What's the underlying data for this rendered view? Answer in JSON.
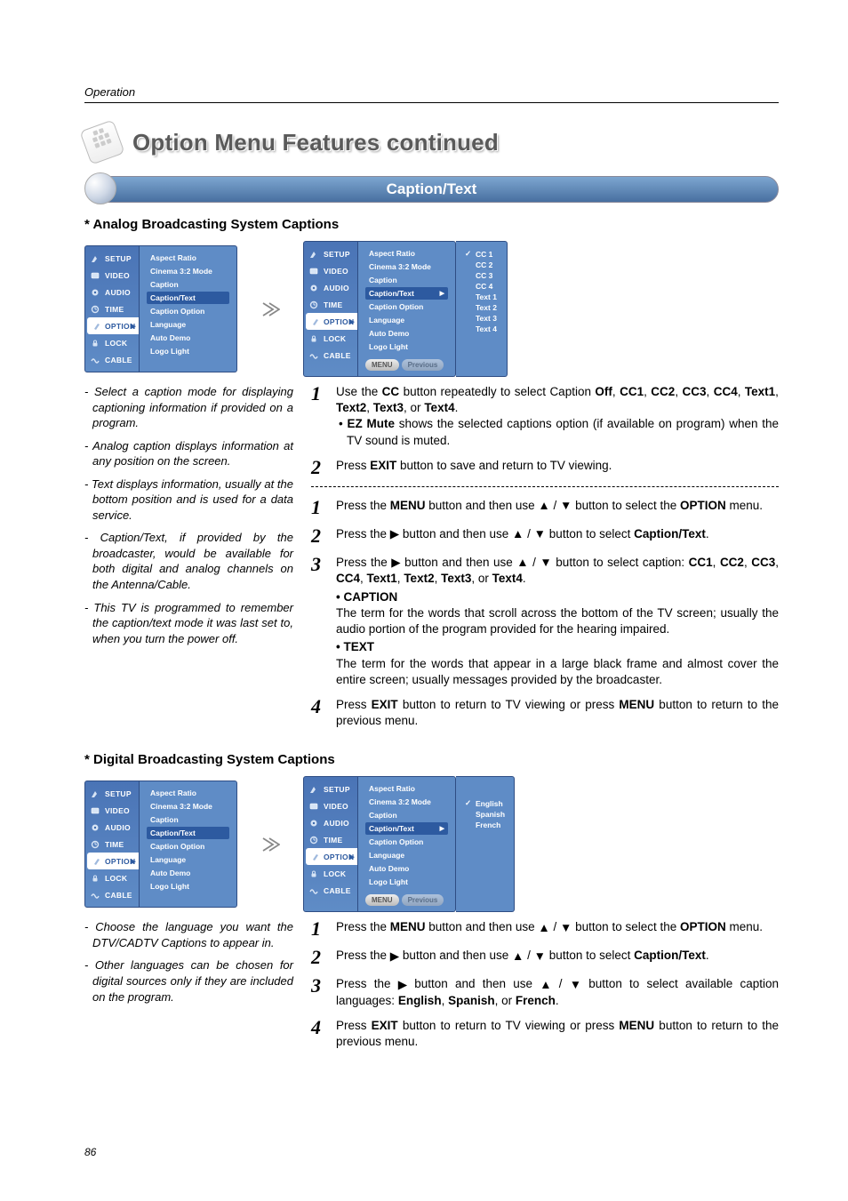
{
  "header": {
    "section": "Operation",
    "title": "Option Menu Features continued",
    "page_number": "86"
  },
  "banner": {
    "label": "Caption/Text"
  },
  "analog": {
    "heading": "* Analog Broadcasting System Captions",
    "osd_left": {
      "tabs": [
        "SETUP",
        "VIDEO",
        "AUDIO",
        "TIME",
        "OPTION",
        "LOCK",
        "CABLE"
      ],
      "selected": "OPTION",
      "options": [
        "Aspect Ratio",
        "Cinema 3:2 Mode",
        "Caption",
        "Caption/Text",
        "Caption Option",
        "Language",
        "Auto Demo",
        "Logo Light"
      ],
      "highlight": "Caption/Text"
    },
    "osd_right": {
      "tabs": [
        "SETUP",
        "VIDEO",
        "AUDIO",
        "TIME",
        "OPTION",
        "LOCK",
        "CABLE"
      ],
      "selected": "OPTION",
      "options": [
        "Aspect Ratio",
        "Cinema 3:2 Mode",
        "Caption",
        "Caption/Text",
        "Caption Option",
        "Language",
        "Auto Demo",
        "Logo Light"
      ],
      "highlight": "Caption/Text",
      "submenu": [
        "CC 1",
        "CC 2",
        "CC 3",
        "CC 4",
        "Text 1",
        "Text 2",
        "Text 3",
        "Text 4"
      ],
      "submenu_selected": "CC 1",
      "buttons": [
        "MENU",
        "Previous"
      ]
    },
    "notes": [
      "- Select a caption mode for displaying captioning information if provided on a program.",
      "- Analog caption displays information at any position on the screen.",
      "- Text displays information, usually at the bottom position and is used for a data service.",
      "- Caption/Text, if provided by the broadcaster, would be available for both digital and analog channels on the Antenna/Cable.",
      "- This TV is programmed to remember the caption/text mode it was last set to, when you turn the power off."
    ],
    "steps_top": [
      {
        "n": "1",
        "html": "Use the <b>CC</b> button repeatedly to select Caption <b>Off</b>, <b>CC1</b>, <b>CC2</b>, <b>CC3</b>, <b>CC4</b>, <b>Text1</b>, <b>Text2</b>, <b>Text3</b>, or <b>Text4</b>.<br><span class='sub'>• <b>EZ Mute</b> shows the selected captions option (if available on program) when the TV sound is muted.</span>"
      },
      {
        "n": "2",
        "html": "Press <b>EXIT</b> button to save and return to TV viewing."
      }
    ],
    "steps_bottom": [
      {
        "n": "1",
        "html": "Press the <b>MENU</b> button and then use <span class='glyph'>▲</span> / <span class='glyph'>▼</span> button to select the <b>OPTION</b> menu."
      },
      {
        "n": "2",
        "html": "Press the <span class='glyph'>▶</span> button and then use <span class='glyph'>▲</span> / <span class='glyph'>▼</span> button to select <b>Caption/Text</b>."
      },
      {
        "n": "3",
        "html": "Press the <span class='glyph'>▶</span> button and then use <span class='glyph'>▲</span> / <span class='glyph'>▼</span> button to select caption: <b>CC1</b>, <b>CC2</b>, <b>CC3</b>, <b>CC4</b>, <b>Text1</b>, <b>Text2</b>, <b>Text3</b>, or <b>Text4</b>.<br><span class='subhead'>• CAPTION</span><span class='desc'>The term for the words that scroll across the bottom of the TV screen; usually the audio portion of the program provided for the hearing impaired.</span><span class='subhead'>• TEXT</span><span class='desc'>The term for the words that appear in a large black frame and almost cover the entire screen; usually messages provided by the broadcaster.</span>"
      },
      {
        "n": "4",
        "html": "Press <b>EXIT</b> button to return to TV viewing or press <b>MENU</b> button to return to the previous menu."
      }
    ]
  },
  "digital": {
    "heading": "* Digital Broadcasting System Captions",
    "osd_left": {
      "tabs": [
        "SETUP",
        "VIDEO",
        "AUDIO",
        "TIME",
        "OPTION",
        "LOCK",
        "CABLE"
      ],
      "selected": "OPTION",
      "options": [
        "Aspect Ratio",
        "Cinema 3:2 Mode",
        "Caption",
        "Caption/Text",
        "Caption Option",
        "Language",
        "Auto Demo",
        "Logo Light"
      ],
      "highlight": "Caption/Text"
    },
    "osd_right": {
      "tabs": [
        "SETUP",
        "VIDEO",
        "AUDIO",
        "TIME",
        "OPTION",
        "LOCK",
        "CABLE"
      ],
      "selected": "OPTION",
      "options": [
        "Aspect Ratio",
        "Cinema 3:2 Mode",
        "Caption",
        "Caption/Text",
        "Caption Option",
        "Language",
        "Auto Demo",
        "Logo Light"
      ],
      "highlight": "Caption/Text",
      "submenu": [
        "English",
        "Spanish",
        "French"
      ],
      "submenu_selected": "English",
      "buttons": [
        "MENU",
        "Previous"
      ]
    },
    "notes": [
      "- Choose the language you want the DTV/CADTV Captions to appear in.",
      "- Other languages can be chosen for digital sources only if they are included on the program."
    ],
    "steps": [
      {
        "n": "1",
        "html": "Press the <b>MENU</b> button and then use <span class='glyph'>▲</span> / <span class='glyph'>▼</span> button to select the <b>OPTION</b> menu."
      },
      {
        "n": "2",
        "html": "Press the <span class='glyph'>▶</span> button and then use <span class='glyph'>▲</span> / <span class='glyph'>▼</span> button to select <b>Caption/Text</b>."
      },
      {
        "n": "3",
        "html": "Press the <span class='glyph'>▶</span> button and then use <span class='glyph'>▲</span> / <span class='glyph'>▼</span> button to select available caption languages: <b>English</b>, <b>Spanish</b>, or <b>French</b>."
      },
      {
        "n": "4",
        "html": "Press <b>EXIT</b> button to return to TV viewing or press <b>MENU</b> button to return to the previous menu."
      }
    ]
  },
  "icons": {
    "setup": "<svg class='ic' viewBox='0 0 10 10'><path d='M1 9 L5 2 L7 5 L4 9 Z' fill='#d7e4f5'/></svg>",
    "video": "<svg class='ic' viewBox='0 0 10 10'><rect x='1' y='2' width='8' height='6' rx='1' fill='#d7e4f5' stroke='#fff' stroke-width='.6'/></svg>",
    "audio": "<svg class='ic' viewBox='0 0 10 10'><circle cx='5' cy='5' r='3.5' fill='#d7e4f5'/><circle cx='5' cy='5' r='1.2' fill='#3d6aac'/></svg>",
    "time": "<svg class='ic' viewBox='0 0 10 10'><circle cx='5' cy='5' r='3.5' fill='none' stroke='#d7e4f5' stroke-width='1.4'/><path d='M5 5 L5 2.5 M5 5 L7 5' stroke='#d7e4f5' stroke-width='1'/></svg>",
    "option": "<svg class='ic' viewBox='0 0 10 10'><path d='M2 8 L6 2 L8 3 L4 9 Z' fill='#9fb9dd'/></svg>",
    "lock": "<svg class='ic' viewBox='0 0 10 10'><rect x='2.5' y='4.5' width='5' height='4' rx='1' fill='#d7e4f5'/><path d='M3.5 4.5 V3.5 a1.5 1.5 0 0 1 3 0 V4.5' fill='none' stroke='#d7e4f5' stroke-width='1'/></svg>",
    "cable": "<svg class='ic' viewBox='0 0 10 10'><path d='M1 6 Q3 2 5 6 T9 6' fill='none' stroke='#d7e4f5' stroke-width='1.4'/></svg>"
  }
}
